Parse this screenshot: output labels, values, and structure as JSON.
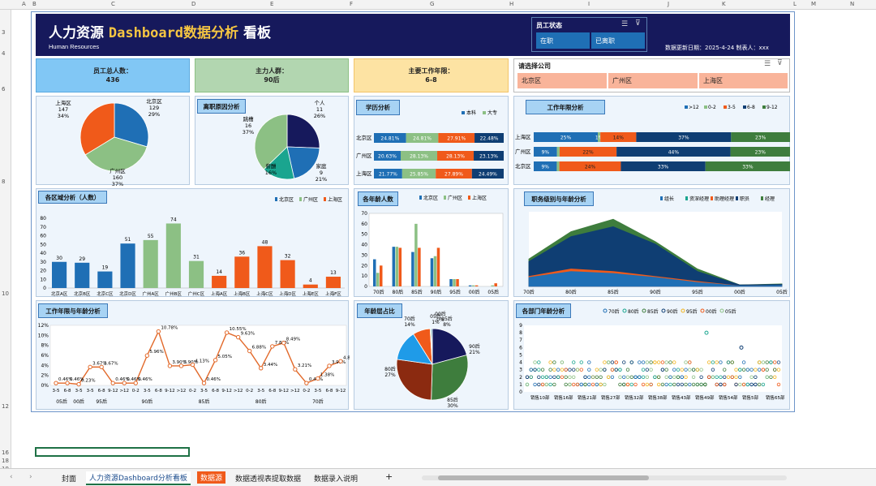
{
  "columns": [
    "A",
    "B",
    "C",
    "D",
    "E",
    "F",
    "G",
    "H",
    "I",
    "J",
    "K",
    "L",
    "M",
    "N"
  ],
  "rows": [
    "3",
    "4",
    "6",
    "8",
    "10",
    "12",
    "16",
    "18",
    "19"
  ],
  "header": {
    "title_main": "人力资源 ",
    "title_hl": "Dashboard数据分析",
    "title_tail": " 看板",
    "subtitle": "Human Resources",
    "update": "数据更新日期：2025-4-24    制表人：xxx"
  },
  "slicer_status": {
    "title": "员工状态",
    "items": [
      "在职",
      "已离职"
    ]
  },
  "slicer_company": {
    "title": "请选择公司",
    "items": [
      "北京区",
      "广州区",
      "上海区"
    ]
  },
  "kpi": [
    {
      "label": "员工总人数：",
      "value": "436"
    },
    {
      "label": "主力人群：",
      "value": "90后"
    },
    {
      "label": "主要工作年限：",
      "value": "6-8"
    }
  ],
  "chart_data": [
    {
      "id": "region_pie",
      "type": "pie",
      "title": "",
      "slices": [
        {
          "name": "北京区",
          "value": 129,
          "pct": "29%"
        },
        {
          "name": "广州区",
          "value": 160,
          "pct": "37%"
        },
        {
          "name": "上海区",
          "value": 147,
          "pct": "34%"
        }
      ],
      "colors": [
        "#1f6fb5",
        "#8cc084",
        "#f05a1a"
      ]
    },
    {
      "id": "leave_pie",
      "type": "pie",
      "title": "离职原因分析",
      "slices": [
        {
          "name": "个人",
          "value": 11,
          "pct": "26%"
        },
        {
          "name": "家庭",
          "value": 9,
          "pct": "21%"
        },
        {
          "name": "薪酬",
          "value": 7,
          "pct": "16%"
        },
        {
          "name": "跳槽",
          "value": 16,
          "pct": "37%"
        }
      ],
      "colors": [
        "#16195c",
        "#1f6fb5",
        "#1aa58f",
        "#8cc084"
      ]
    },
    {
      "id": "edu_bar",
      "type": "bar",
      "title": "学历分析",
      "legend": [
        "本科",
        "大专"
      ],
      "categories": [
        "北京区",
        "广州区",
        "上海区"
      ],
      "segments": [
        [
          "24.81%",
          "24.81%",
          "27.91%",
          "22.48%"
        ],
        [
          "20.63%",
          "28.13%",
          "28.13%",
          "23.13%"
        ],
        [
          "21.77%",
          "25.85%",
          "27.89%",
          "24.49%"
        ]
      ],
      "colors": [
        "#1f6fb5",
        "#8cc084",
        "#f05a1a",
        "#0f3e73"
      ]
    },
    {
      "id": "tenure_bar",
      "type": "bar",
      "title": "工作年限分析",
      "legend": [
        ">12",
        "0-2",
        "3-5",
        "6-8",
        "9-12"
      ],
      "categories": [
        "上海区",
        "广州区",
        "北京区"
      ],
      "segments": [
        [
          "25%",
          "1%",
          "14%",
          "37%",
          "23%"
        ],
        [
          "9%",
          "",
          "22%",
          "44%",
          "23%"
        ],
        [
          "9%",
          "",
          "24%",
          "33%",
          "33%"
        ]
      ],
      "values": [
        [
          25,
          1,
          14,
          37,
          23
        ],
        [
          9,
          1,
          22,
          44,
          23
        ],
        [
          9,
          1,
          24,
          33,
          33
        ]
      ],
      "colors": [
        "#1f6fb5",
        "#8cc084",
        "#f05a1a",
        "#0f3e73",
        "#3e7d3d"
      ]
    },
    {
      "id": "dept_bar",
      "type": "bar",
      "title": "各区域分析（人数）",
      "legend": [
        "北京区",
        "广州区",
        "上海区"
      ],
      "categories": [
        "北京A区",
        "北京B区",
        "北京C区",
        "北京D区",
        "广州A区",
        "广州B区",
        "广州C区",
        "上海A区",
        "上海B区",
        "上海C区",
        "上海D区",
        "上海E区",
        "上海F区"
      ],
      "values": [
        30,
        29,
        19,
        51,
        55,
        74,
        31,
        14,
        36,
        48,
        32,
        4,
        13
      ],
      "colors": [
        "#1f6fb5",
        "#1f6fb5",
        "#1f6fb5",
        "#1f6fb5",
        "#8cc084",
        "#8cc084",
        "#8cc084",
        "#f05a1a",
        "#f05a1a",
        "#f05a1a",
        "#f05a1a",
        "#f05a1a",
        "#f05a1a"
      ],
      "yticks": [
        "0",
        "10",
        "20",
        "30",
        "40",
        "50",
        "60",
        "70",
        "80"
      ],
      "ylim": [
        0,
        80
      ]
    },
    {
      "id": "age_bar",
      "type": "bar",
      "title": "各年龄人数",
      "legend": [
        "北京区",
        "广州区",
        "上海区"
      ],
      "categories": [
        "70后",
        "80后",
        "85后",
        "90后",
        "95后",
        "00后",
        "05后"
      ],
      "series": [
        [
          26,
          38,
          33,
          27,
          7,
          1,
          0
        ],
        [
          13,
          38,
          60,
          29,
          7,
          1,
          1
        ],
        [
          20,
          37,
          37,
          37,
          7,
          1,
          3
        ]
      ],
      "yticks": [
        "0",
        "10",
        "20",
        "30",
        "40",
        "50",
        "60",
        "70"
      ],
      "ylim": [
        0,
        70
      ]
    },
    {
      "id": "level_area",
      "type": "area",
      "title": "职务级别与年龄分析",
      "legend": [
        "组长",
        "资深经理",
        "助理经理",
        "职员",
        "经理"
      ],
      "categories": [
        "70后",
        "80后",
        "85后",
        "90后",
        "95后",
        "00后",
        "05后"
      ],
      "series": [
        {
          "values": [
            55,
            110,
            135,
            90,
            35,
            3,
            5
          ],
          "color": "#3e7d3d"
        },
        {
          "values": [
            50,
            100,
            120,
            85,
            30,
            3,
            4
          ],
          "color": "#0f3e73"
        },
        {
          "values": [
            20,
            35,
            30,
            20,
            10,
            1,
            2
          ],
          "color": "#f05a1a"
        },
        {
          "values": [
            18,
            30,
            26,
            18,
            8,
            1,
            2
          ],
          "color": "#1f6fb5"
        }
      ],
      "ylim": [
        0,
        150
      ]
    },
    {
      "id": "tenure_line",
      "type": "line",
      "title": "工作年限与年龄分析",
      "yticks": [
        "0%",
        "2%",
        "4%",
        "6%",
        "8%",
        "10%",
        "12%"
      ],
      "ylim": [
        0,
        12
      ],
      "values": [
        0.46,
        0.46,
        0.23,
        3.67,
        3.67,
        0.46,
        0.46,
        0.46,
        5.96,
        10.78,
        3.9,
        3.9,
        4.13,
        0.46,
        5.05,
        10.55,
        9.63,
        6.88,
        3.44,
        7.8,
        8.49,
        3.21,
        0.46,
        1.38,
        3.9,
        4.82
      ],
      "labels": [
        "0.46%",
        "0.46%",
        "0.23%",
        "3.67%",
        "3.67%",
        "0.46%",
        "0.46%",
        "0.46%",
        "5.96%",
        "10.78%",
        "3.90%",
        "3.90%",
        "4.13%",
        "0.46%",
        "5.05%",
        "10.55%",
        "9.63%",
        "6.88%",
        "3.44%",
        "7.80%",
        "8.49%",
        "3.21%",
        "0.46%",
        "1.38%",
        "3.90%",
        "4.82%"
      ],
      "x1": [
        "3-5",
        "6-8",
        "3-5",
        "3-5",
        "6-8",
        "9-12",
        ">12",
        "0-2",
        "3-5",
        "6-8",
        "9-12",
        ">12",
        "0-2",
        "3-5",
        "6-8",
        "9-12",
        ">12",
        "0-2",
        "3-5",
        "6-8",
        "9-12",
        ">12",
        "0-2",
        "3-5",
        "6-8",
        "9-12"
      ],
      "x2": [
        "05后",
        "00后",
        "95后",
        "90后",
        "85后",
        "80后",
        "70后"
      ]
    },
    {
      "id": "agegroup_pie",
      "type": "pie",
      "title": "年龄层占比",
      "slices": [
        {
          "name": "90后",
          "pct": "21%"
        },
        {
          "name": "85后",
          "pct": "30%"
        },
        {
          "name": "80后",
          "pct": "27%"
        },
        {
          "name": "70后",
          "pct": "14%"
        },
        {
          "name": "95后",
          "pct": "8%"
        },
        {
          "name": "00后",
          "pct": "0%"
        },
        {
          "name": "05后",
          "pct": "1%"
        }
      ],
      "values": [
        21,
        30,
        27,
        14,
        8,
        0.5,
        0.5
      ],
      "colors": [
        "#16195c",
        "#3e7d3d",
        "#8b2a10",
        "#1f9be8",
        "#f05a1a",
        "#8cc084",
        "#1f6fb5"
      ]
    },
    {
      "id": "dept_scatter",
      "type": "scatter",
      "title": "各部门年龄分析",
      "legend": [
        "70后",
        "80后",
        "85后",
        "90后",
        "95后",
        "00后",
        "05后"
      ],
      "yticks": [
        "0",
        "1",
        "2",
        "3",
        "4",
        "5",
        "6",
        "7",
        "8",
        "9"
      ],
      "ylim": [
        0,
        9
      ],
      "xticks": [
        "销售10部",
        "销售16部",
        "销售21部",
        "销售27部",
        "销售32部",
        "销售38部",
        "销售43部",
        "销售49部",
        "销售54部",
        "销售5部",
        "销售65部"
      ],
      "colors": [
        "#1f6fb5",
        "#1aa58f",
        "#3e7d3d",
        "#0f3e73",
        "#f2b41e",
        "#f05a1a",
        "#8cc084"
      ]
    }
  ],
  "tabs": [
    "封面",
    "人力资源Dashboard分析看板",
    "数据源",
    "数据透视表提取数据",
    "数据录入说明",
    "+"
  ]
}
